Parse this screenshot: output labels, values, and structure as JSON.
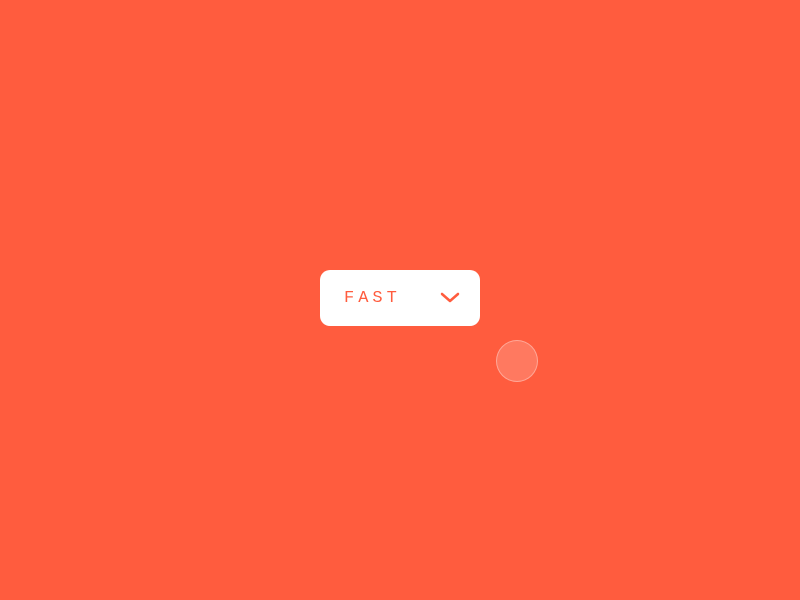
{
  "dropdown": {
    "label": "FAST"
  },
  "colors": {
    "background": "#ff5c3e",
    "dropdown_bg": "#ffffff",
    "text": "#ff5c3e"
  }
}
